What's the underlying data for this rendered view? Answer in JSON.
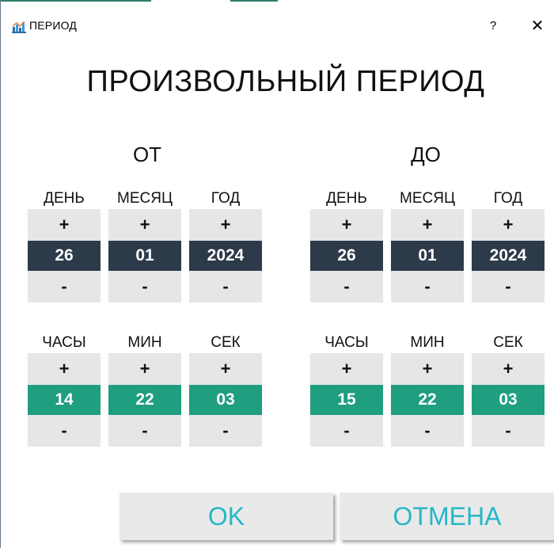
{
  "window": {
    "title": "ПЕРИОД",
    "help_label": "?",
    "close_label": "✕"
  },
  "heading": "ПРОИЗВОЛЬНЫЙ ПЕРИОД",
  "from": {
    "label": "ОТ",
    "date": [
      {
        "label": "ДЕНЬ",
        "value": "26"
      },
      {
        "label": "МЕСЯЦ",
        "value": "01"
      },
      {
        "label": "ГОД",
        "value": "2024"
      }
    ],
    "time": [
      {
        "label": "ЧАСЫ",
        "value": "14"
      },
      {
        "label": "МИН",
        "value": "22"
      },
      {
        "label": "СЕК",
        "value": "03"
      }
    ]
  },
  "to": {
    "label": "ДО",
    "date": [
      {
        "label": "ДЕНЬ",
        "value": "26"
      },
      {
        "label": "МЕСЯЦ",
        "value": "01"
      },
      {
        "label": "ГОД",
        "value": "2024"
      }
    ],
    "time": [
      {
        "label": "ЧАСЫ",
        "value": "15"
      },
      {
        "label": "МИН",
        "value": "22"
      },
      {
        "label": "СЕК",
        "value": "03"
      }
    ]
  },
  "spinner": {
    "plus": "+",
    "minus": "-"
  },
  "buttons": {
    "ok": "OK",
    "cancel": "ОТМЕНА"
  },
  "colors": {
    "date_value_bg": "#2d3a4a",
    "time_value_bg": "#1f9e80",
    "button_text": "#25b7c8"
  }
}
